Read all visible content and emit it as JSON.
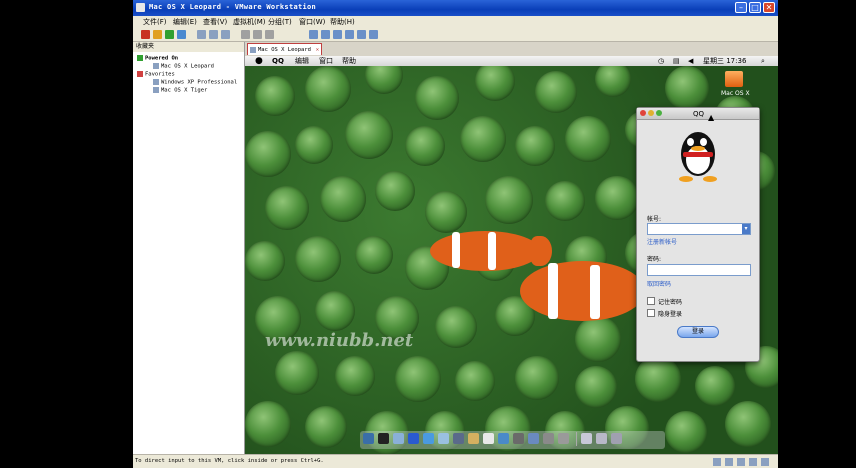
{
  "window": {
    "title": "Mac OS X Leopard - VMware Workstation",
    "controls": [
      "–",
      "□",
      "✕"
    ]
  },
  "menubar": [
    "文件(F)",
    "编辑(E)",
    "查看(V)",
    "虚拟机(M)",
    "分组(T)",
    "窗口(W)",
    "帮助(H)"
  ],
  "sidebar": {
    "header": "收藏夹",
    "tree": [
      {
        "label": "Powered On",
        "level": 0
      },
      {
        "label": "Mac OS X Leopard",
        "level": 1
      },
      {
        "label": "Favorites",
        "level": 0
      },
      {
        "label": "Windows XP Professional",
        "level": 1
      },
      {
        "label": "Mac OS X Tiger",
        "level": 1
      }
    ]
  },
  "tab": {
    "label": "Mac OS X Leopard",
    "close": "✕"
  },
  "status": "To direct input to this VM, click inside or press Ctrl+G.",
  "mac": {
    "menu": [
      "QQ",
      "编辑",
      "窗口",
      "帮助"
    ],
    "clock": "星期三 17:36",
    "desktop_icon_label": "Mac OS X",
    "watermark": "www.niubb.net"
  },
  "qq": {
    "title": "QQ",
    "account_label": "帐号:",
    "account_value": "",
    "register_link": "注册新帐号",
    "password_label": "密码:",
    "password_value": "",
    "forgot_link": "取回密码",
    "remember_label": "记住密码",
    "hidden_label": "隐身登录",
    "login_button": "登录"
  },
  "colors": {
    "title_bar": "#0a3fb8",
    "qq_link": "#2a5cc8",
    "clownfish": "#e0601a"
  }
}
